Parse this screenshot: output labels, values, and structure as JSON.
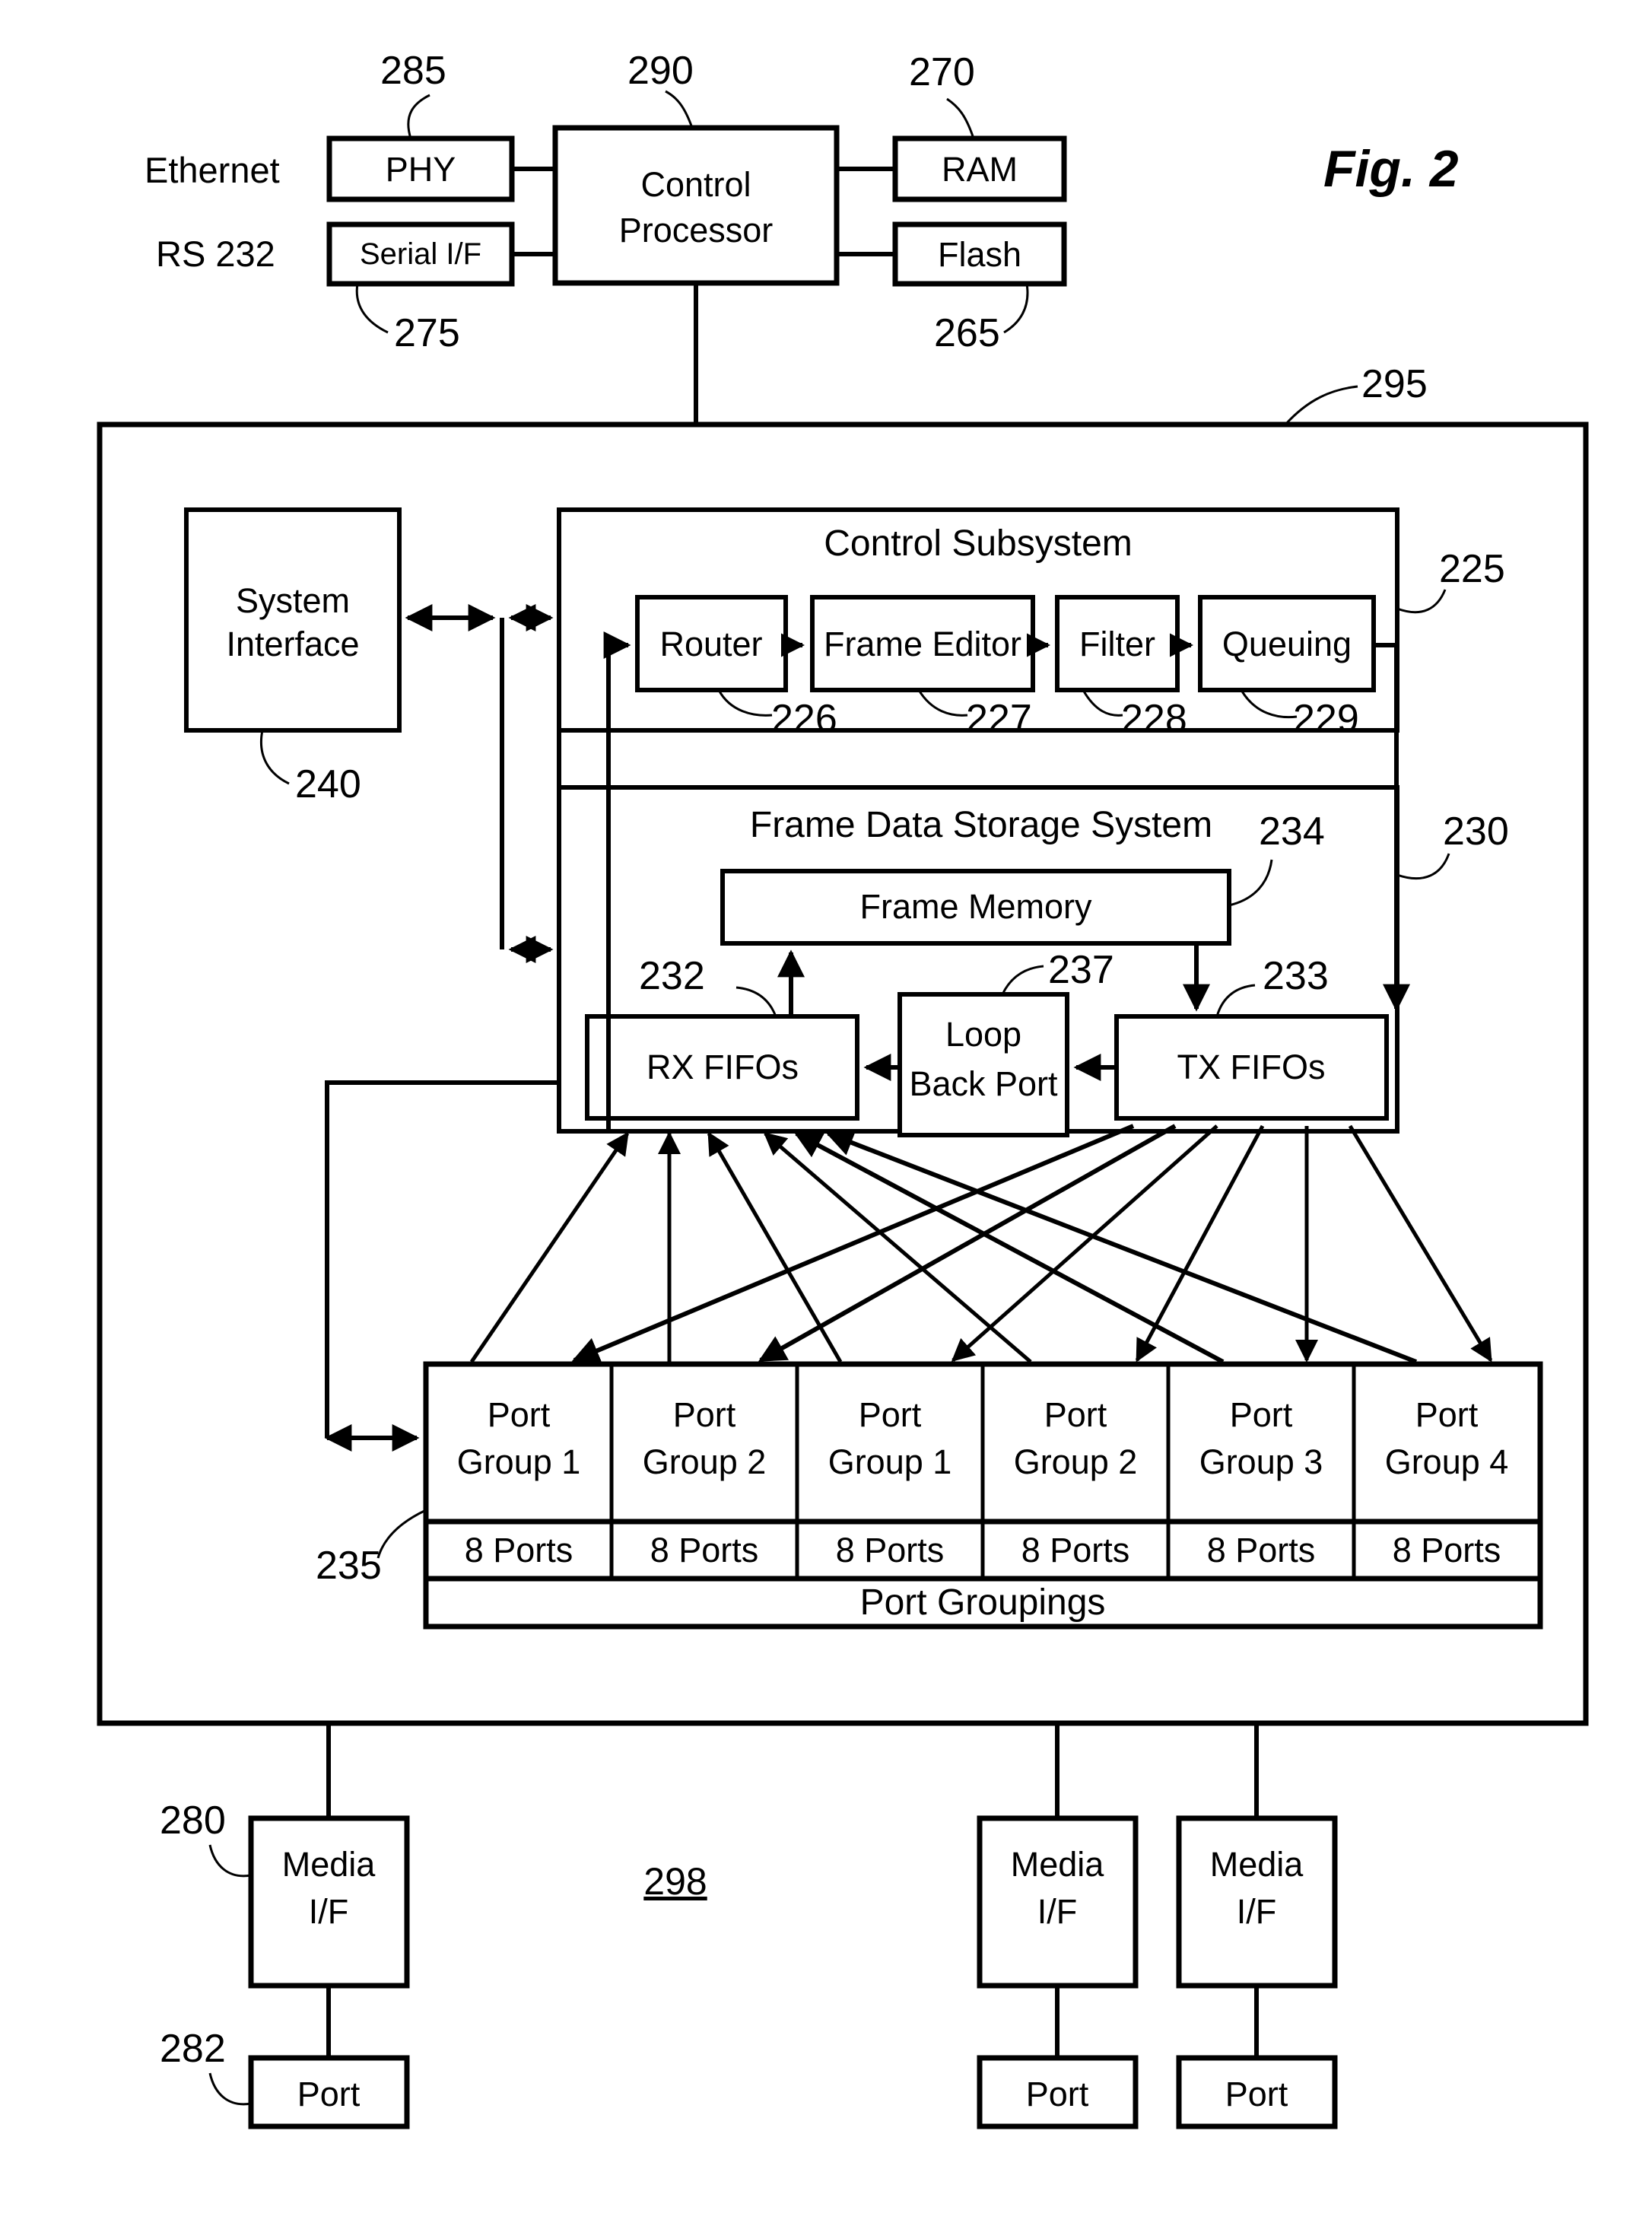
{
  "figure": {
    "label": "Fig. 2",
    "system_ref": "298"
  },
  "top_section": {
    "left_labels": [
      {
        "text": "Ethernet",
        "ref": ""
      },
      {
        "text": "RS 232",
        "ref": ""
      }
    ],
    "boxes": [
      {
        "name": "phy",
        "label": "PHY",
        "ref": "285"
      },
      {
        "name": "serial-if",
        "label": "Serial I/F",
        "ref": "275"
      },
      {
        "name": "control-processor",
        "label_line1": "Control",
        "label_line2": "Processor",
        "ref": "290"
      },
      {
        "name": "ram",
        "label": "RAM",
        "ref": "270"
      },
      {
        "name": "flash",
        "label": "Flash",
        "ref": "265"
      }
    ]
  },
  "main_chip": {
    "ref": "295",
    "system_interface": {
      "label_line1": "System",
      "label_line2": "Interface",
      "ref": "240"
    },
    "control_subsystem": {
      "title": "Control Subsystem",
      "ref": "225",
      "stages": [
        {
          "label": "Router",
          "ref": "226"
        },
        {
          "label": "Frame Editor",
          "ref": "227"
        },
        {
          "label": "Filter",
          "ref": "228"
        },
        {
          "label": "Queuing",
          "ref": "229"
        }
      ]
    },
    "frame_data_storage": {
      "title": "Frame Data Storage System",
      "ref": "230",
      "frame_memory": {
        "label": "Frame Memory",
        "ref": "234"
      },
      "rx_fifos": {
        "label": "RX FIFOs",
        "ref": "232"
      },
      "tx_fifos": {
        "label": "TX FIFOs",
        "ref": "233"
      },
      "loop_back_port": {
        "label_line1": "Loop",
        "label_line2": "Back Port",
        "ref": "237"
      }
    },
    "port_groupings": {
      "ref": "235",
      "footer": "Port Groupings",
      "columns": [
        {
          "group_line1": "Port",
          "group_line2": "Group 1",
          "ports": "8 Ports"
        },
        {
          "group_line1": "Port",
          "group_line2": "Group 2",
          "ports": "8 Ports"
        },
        {
          "group_line1": "Port",
          "group_line2": "Group 1",
          "ports": "8 Ports"
        },
        {
          "group_line1": "Port",
          "group_line2": "Group 2",
          "ports": "8 Ports"
        },
        {
          "group_line1": "Port",
          "group_line2": "Group 3",
          "ports": "8 Ports"
        },
        {
          "group_line1": "Port",
          "group_line2": "Group 4",
          "ports": "8 Ports"
        }
      ]
    }
  },
  "bottom_section": {
    "media_if_ref": "280",
    "port_ref": "282",
    "units": [
      {
        "media_line1": "Media",
        "media_line2": "I/F",
        "port": "Port"
      },
      {
        "media_line1": "Media",
        "media_line2": "I/F",
        "port": "Port"
      },
      {
        "media_line1": "Media",
        "media_line2": "I/F",
        "port": "Port"
      }
    ]
  }
}
